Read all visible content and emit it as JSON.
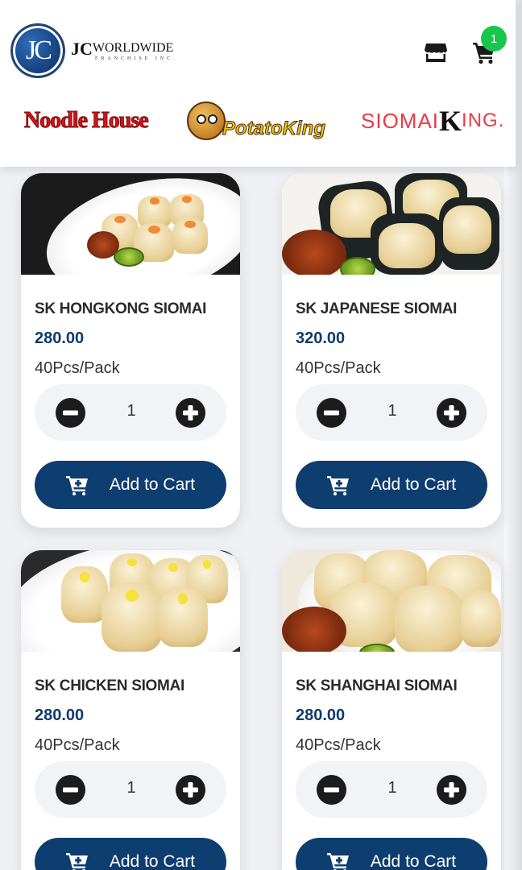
{
  "header": {
    "logo_initials": "JC",
    "logo_jc": "JC",
    "logo_worldwide": "WORLDWIDE",
    "logo_franchise": "FRANCHISE INC.",
    "cart_count": "1"
  },
  "brands": {
    "noodle_house": "Noodle House",
    "potato_king": "PotatoKing",
    "siomai_king_1": "SIOMAI",
    "siomai_king_k": "K",
    "siomai_king_2": "ING."
  },
  "products": [
    {
      "name": "SK HONGKONG SIOMAI",
      "price": "280.00",
      "pack": "40Pcs/Pack",
      "qty": "1",
      "button": "Add to Cart"
    },
    {
      "name": "SK JAPANESE SIOMAI",
      "price": "320.00",
      "pack": "40Pcs/Pack",
      "qty": "1",
      "button": "Add to Cart"
    },
    {
      "name": "SK CHICKEN SIOMAI",
      "price": "280.00",
      "pack": "40Pcs/Pack",
      "qty": "1",
      "button": "Add to Cart"
    },
    {
      "name": "SK SHANGHAI SIOMAI",
      "price": "280.00",
      "pack": "40Pcs/Pack",
      "qty": "1",
      "button": "Add to Cart"
    }
  ],
  "colors": {
    "primary": "#0e3d70",
    "price": "#0f3a6b",
    "badge": "#17c64b"
  }
}
